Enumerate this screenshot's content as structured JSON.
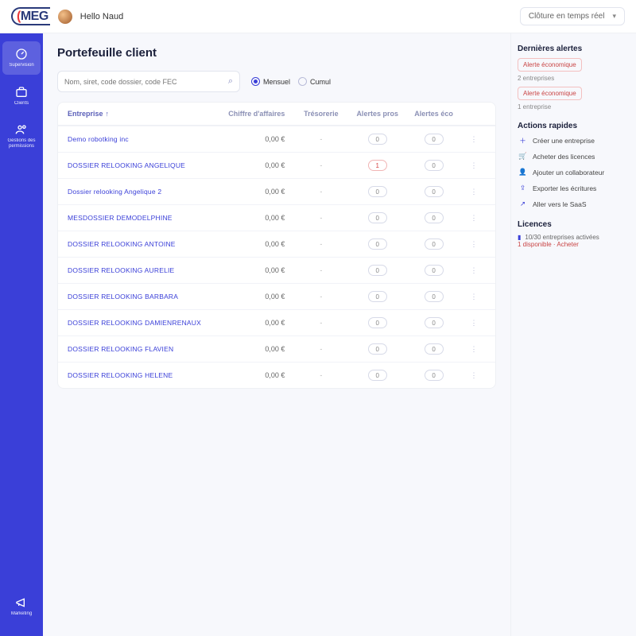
{
  "brand": {
    "name": "MEG"
  },
  "header": {
    "greeting": "Hello Naud",
    "period_label": "Clôture en temps réel"
  },
  "sidebar": {
    "items": [
      {
        "id": "supervision",
        "label": "Supervision"
      },
      {
        "id": "clients",
        "label": "Clients"
      },
      {
        "id": "permissions",
        "label": "Gestions des permissions"
      }
    ],
    "bottom": {
      "id": "marketing",
      "label": "Marketing"
    }
  },
  "page": {
    "title": "Portefeuille client",
    "search_placeholder": "Nom, siret, code dossier, code FEC",
    "period_options": {
      "mensuel": "Mensuel",
      "cumul": "Cumul"
    },
    "period_selected": "mensuel"
  },
  "table": {
    "columns": {
      "entreprise": "Entreprise",
      "chiffre": "Chiffre d'affaires",
      "tresorerie": "Trésorerie",
      "alertes_pros": "Alertes pros",
      "alertes_eco": "Alertes éco"
    },
    "rows": [
      {
        "name": "Demo robotking inc",
        "chiffre": "0,00 €",
        "tresorerie": "-",
        "pros": "0",
        "eco": "0"
      },
      {
        "name": "DOSSIER RELOOKING ANGELIQUE",
        "chiffre": "0,00 €",
        "tresorerie": "-",
        "pros": "1",
        "eco": "0",
        "pros_red": true
      },
      {
        "name": "Dossier relooking Angelique 2",
        "chiffre": "0,00 €",
        "tresorerie": "-",
        "pros": "0",
        "eco": "0"
      },
      {
        "name": "MESDOSSIER DEMODELPHINE",
        "chiffre": "0,00 €",
        "tresorerie": "-",
        "pros": "0",
        "eco": "0"
      },
      {
        "name": "DOSSIER RELOOKING ANTOINE",
        "chiffre": "0,00 €",
        "tresorerie": "-",
        "pros": "0",
        "eco": "0"
      },
      {
        "name": "DOSSIER RELOOKING AURELIE",
        "chiffre": "0,00 €",
        "tresorerie": "-",
        "pros": "0",
        "eco": "0"
      },
      {
        "name": "DOSSIER RELOOKING BARBARA",
        "chiffre": "0,00 €",
        "tresorerie": "-",
        "pros": "0",
        "eco": "0"
      },
      {
        "name": "DOSSIER RELOOKING DAMIENRENAUX",
        "chiffre": "0,00 €",
        "tresorerie": "-",
        "pros": "0",
        "eco": "0"
      },
      {
        "name": "DOSSIER RELOOKING FLAVIEN",
        "chiffre": "0,00 €",
        "tresorerie": "-",
        "pros": "0",
        "eco": "0"
      },
      {
        "name": "DOSSIER RELOOKING HELENE",
        "chiffre": "0,00 €",
        "tresorerie": "-",
        "pros": "0",
        "eco": "0"
      }
    ]
  },
  "right": {
    "alerts_title": "Dernières alertes",
    "alert1": "Alerte économique",
    "alert1_sub": "2 entreprises",
    "alert2": "Alerte économique",
    "alert2_sub": "1 entreprise",
    "quick_title": "Actions rapides",
    "quick_actions": [
      "Créer une entreprise",
      "Acheter des licences",
      "Ajouter un collaborateur",
      "Exporter les écritures",
      "Aller vers le SaaS"
    ],
    "licences_title": "Licences",
    "licences_line": "10/30 entreprises activées",
    "licences_link": "1 disponible · Acheter"
  }
}
